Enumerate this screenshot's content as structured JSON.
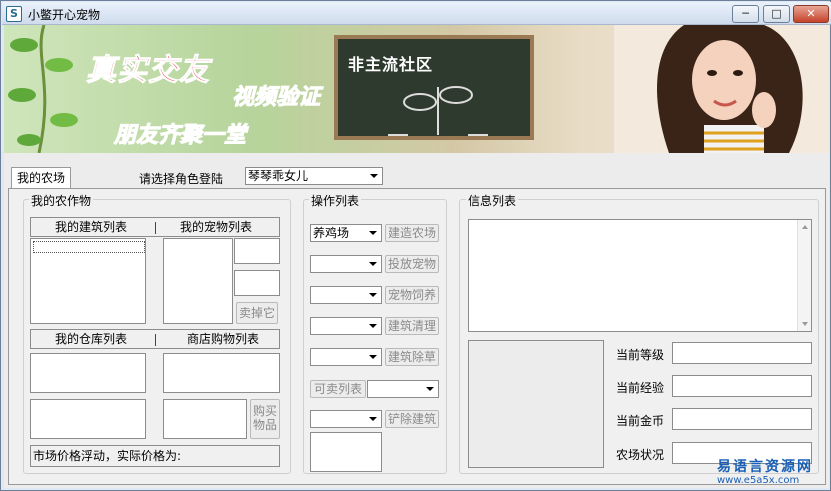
{
  "window": {
    "title": "小鳖开心宠物",
    "min_glyph": "─",
    "max_glyph": "□",
    "close_glyph": "✕",
    "icon_glyph": "S"
  },
  "banner": {
    "slogan_main": "真实交友",
    "slogan_verify": "视频验证",
    "slogan_gather": "朋友齐聚一堂",
    "board_text": "非主流社区"
  },
  "tabs": {
    "farm_label": "我的农场"
  },
  "role": {
    "label": "请选择角色登陆",
    "selected": "琴琴乖女儿"
  },
  "crops": {
    "group_title": "我的农作物",
    "building_list_header": "我的建筑列表",
    "pet_list_header": "我的宠物列表",
    "warehouse_list_header": "我的仓库列表",
    "shop_list_header": "商店购物列表",
    "sell_button": "卖掉它",
    "buy_button": "购买物品",
    "market_text": "市场价格浮动，实际价格为:"
  },
  "operations": {
    "group_title": "操作列表",
    "farm_type_selected": "养鸡场",
    "build_farm_button": "建造农场",
    "place_pet_button": "投放宠物",
    "feed_pet_button": "宠物饲养",
    "clean_building_button": "建筑清理",
    "weed_building_button": "建筑除草",
    "sellable_list_button": "可卖列表",
    "demolish_button": "铲除建筑"
  },
  "info": {
    "group_title": "信息列表",
    "level_label": "当前等级",
    "exp_label": "当前经验",
    "gold_label": "当前金币",
    "farm_status_label": "农场状况"
  },
  "watermark": {
    "name": "易语言资源网",
    "url": "www.e5a5x.com"
  },
  "colors": {
    "title_bar": "#cfdced",
    "watermark": "#1a5fb4",
    "slogan_red": "#e3242b"
  }
}
